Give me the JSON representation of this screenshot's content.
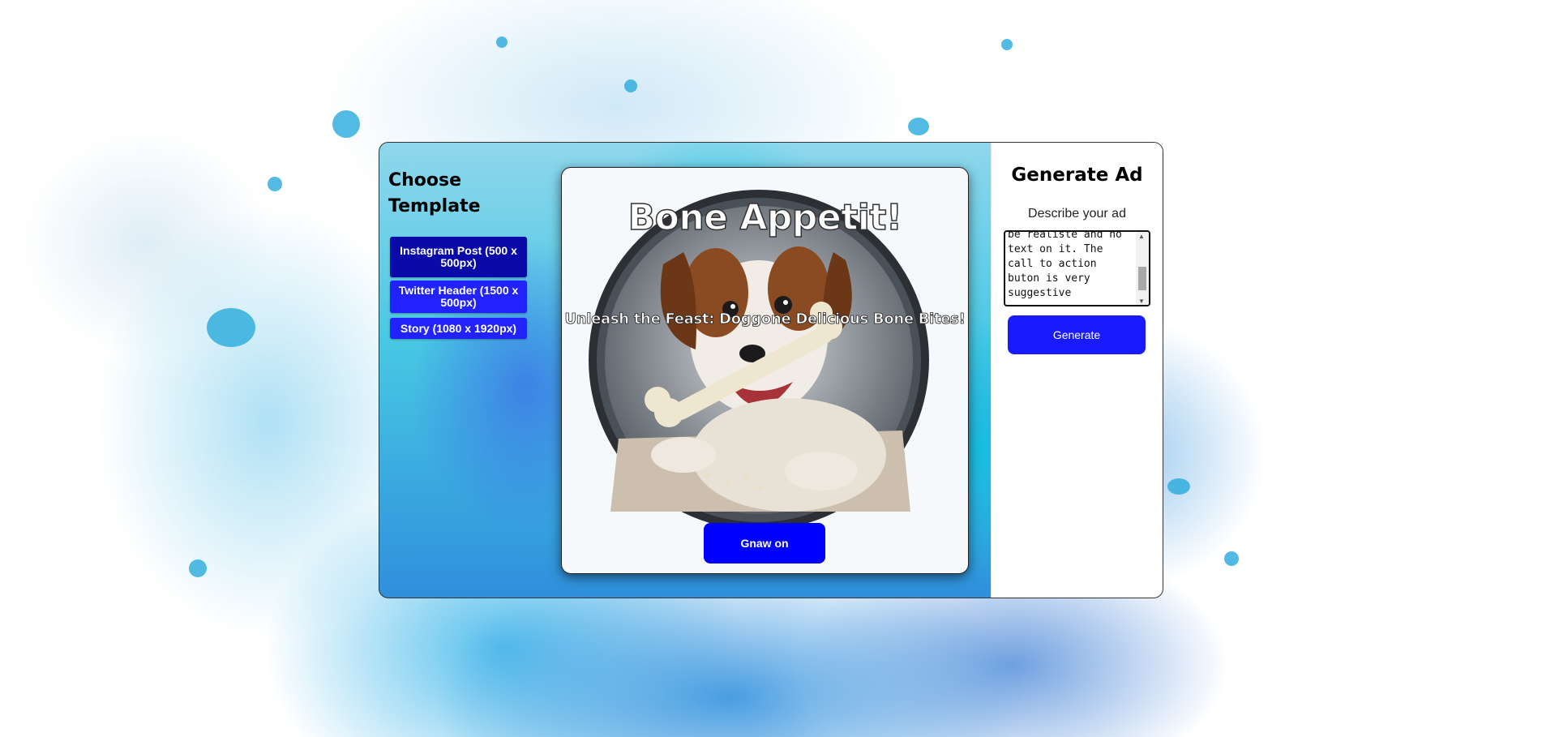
{
  "templates": {
    "title": "Choose Template",
    "items": [
      {
        "label": "Instagram Post (500 x 500px)"
      },
      {
        "label": "Twitter Header (1500 x 500px)"
      },
      {
        "label": "Story (1080 x 1920px)"
      }
    ]
  },
  "preview": {
    "headline": "Bone Appetit!",
    "subheadline": "Unleash the Feast: Doggone Delicious Bone Bites!",
    "cta_label": "Gnaw on"
  },
  "generator": {
    "title": "Generate Ad",
    "describe_label": "Describe your ad",
    "description_value": "be realiste and no\ntext on it. The\ncall to action\nbuton is very\nsuggestive",
    "generate_label": "Generate"
  },
  "colors": {
    "template_active": "#0a0aa8",
    "template_button": "#2222ff",
    "cta": "#0000ff",
    "generate_button": "#1a1aff"
  },
  "icons": [
    "scroll-up-icon",
    "scroll-down-icon",
    "dog-illustration"
  ]
}
